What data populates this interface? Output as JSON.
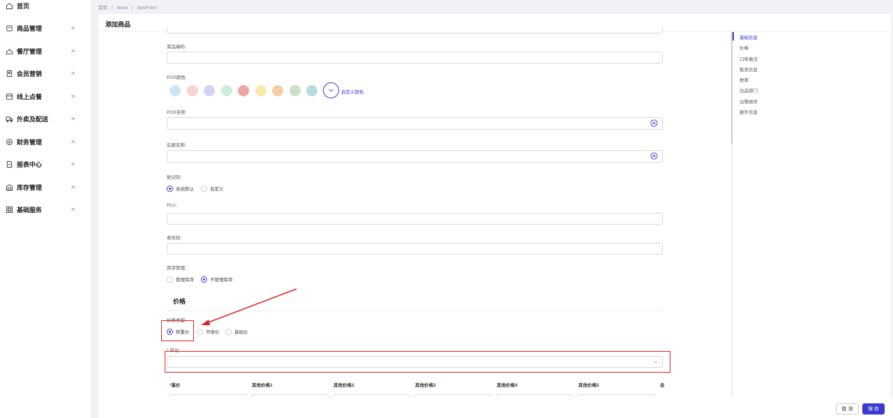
{
  "sidebar": {
    "items": [
      {
        "label": "首页",
        "icon": "home-icon",
        "has_chevron": false
      },
      {
        "label": "商品管理",
        "icon": "product-icon",
        "has_chevron": true
      },
      {
        "label": "餐厅管理",
        "icon": "restaurant-icon",
        "has_chevron": true
      },
      {
        "label": "会员营销",
        "icon": "member-icon",
        "has_chevron": true
      },
      {
        "label": "线上点餐",
        "icon": "online-order-icon",
        "has_chevron": true
      },
      {
        "label": "外卖及配送",
        "icon": "delivery-truck-icon",
        "has_chevron": true
      },
      {
        "label": "财务管理",
        "icon": "finance-icon",
        "has_chevron": true
      },
      {
        "label": "报表中心",
        "icon": "report-icon",
        "has_chevron": true
      },
      {
        "label": "库存管理",
        "icon": "warehouse-icon",
        "has_chevron": true
      },
      {
        "label": "基础服务",
        "icon": "grid-icon",
        "has_chevron": true
      }
    ],
    "chevron": ">"
  },
  "breadcrumb": [
    "首页",
    "/",
    "Items",
    "/",
    "ItemForm"
  ],
  "page": {
    "title": "添加商品"
  },
  "form": {
    "dish_code_label": "菜品编码:",
    "pos_color_label": "POS颜色:",
    "pos_colors": [
      "#cfe4f7",
      "#f7d3d3",
      "#d2d2f5",
      "#cdeedd",
      "#eda5a5",
      "#f8eaa8",
      "#f3cfa8",
      "#cde0c7",
      "#b9dae3"
    ],
    "custom_color_label": "自定义颜色",
    "pos_name_label": "POS名称:",
    "kitchen_name_label": "后厨名称:",
    "mnemonic_label": "助记码:",
    "mnemonic_options": [
      "系统默认",
      "自定义"
    ],
    "mnemonic_selected": 0,
    "plu_label": "PLU:",
    "barcode_label": "条形码:",
    "stock_label": "库存管理:",
    "stock_options": [
      "管理库存",
      "不管理库存"
    ],
    "stock_selected": 1,
    "price_section_title": "价格",
    "price_type_label": "价格类型:",
    "price_type_options": [
      "称重价",
      "开放价",
      "基础价"
    ],
    "price_type_selected": 0,
    "unit_label": "单位:",
    "unit_required": "*",
    "price_columns": [
      "基价",
      "其他价格1",
      "其他价格2",
      "其他价格3",
      "其他价格4",
      "其他价格5",
      "会"
    ],
    "base_price_required": "*"
  },
  "anchors": {
    "items": [
      "基础信息",
      "价格",
      "口味做法",
      "售卖信息",
      "税率",
      "出品部门",
      "出餐顺序",
      "额外信息"
    ],
    "active": 0
  },
  "footer": {
    "cancel_label": "取 消",
    "save_label": "保 存"
  },
  "colors": {
    "accent": "#3b3bcf",
    "annotation_red": "#e02020"
  }
}
